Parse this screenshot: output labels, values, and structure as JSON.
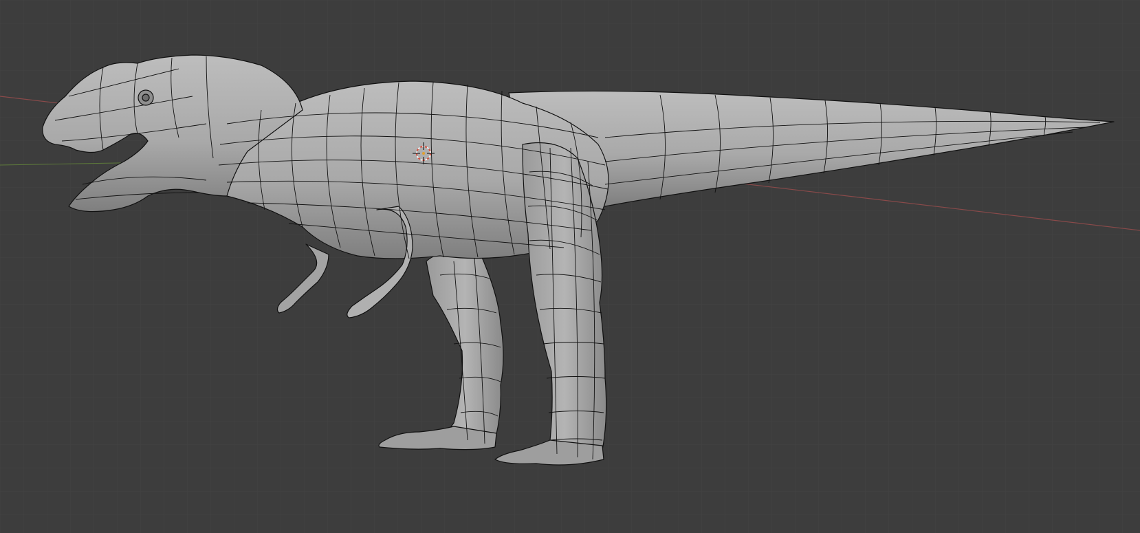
{
  "viewport": {
    "background": "#3d3d3d",
    "grid_color": "#464646",
    "x_axis_color": "#8a4a4a",
    "y_axis_color": "#5d7a3a"
  },
  "model": {
    "body_color": "#a9a9a9",
    "body_shadow_color": "#8d8d8d",
    "wire_color": "#111111",
    "icon": "trex-mesh-icon"
  },
  "cursor": {
    "ring_color_a": "#d94a3a",
    "ring_color_b": "#f0f0f0",
    "icon": "3d-cursor-icon"
  }
}
